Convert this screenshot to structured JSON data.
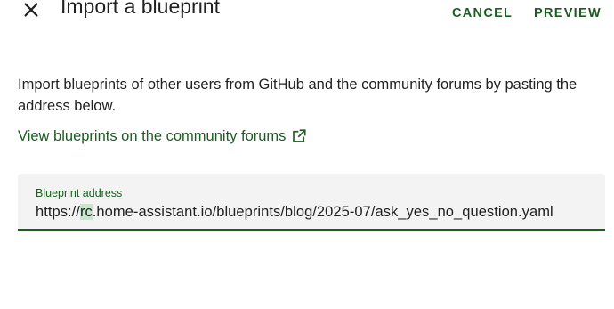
{
  "dialog": {
    "title": "Import a blueprint",
    "description": "Import blueprints of other users from GitHub and the community forums by pasting the address below.",
    "community_link": "View blueprints on the community forums",
    "field": {
      "label": "Blueprint address",
      "value_prefix": "https://",
      "value_selected": "rc",
      "value_suffix": ".home-assistant.io/blueprints/blog/2025-07/ask_yes_no_question.yaml"
    },
    "actions": {
      "cancel": "CANCEL",
      "preview": "PREVIEW"
    },
    "icons": {
      "close": "close-icon",
      "external_link": "open-in-new-icon"
    },
    "colors": {
      "accent": "#1b5e20",
      "selection": "#c8e6c9",
      "field_bg": "#f3f3f3"
    }
  }
}
